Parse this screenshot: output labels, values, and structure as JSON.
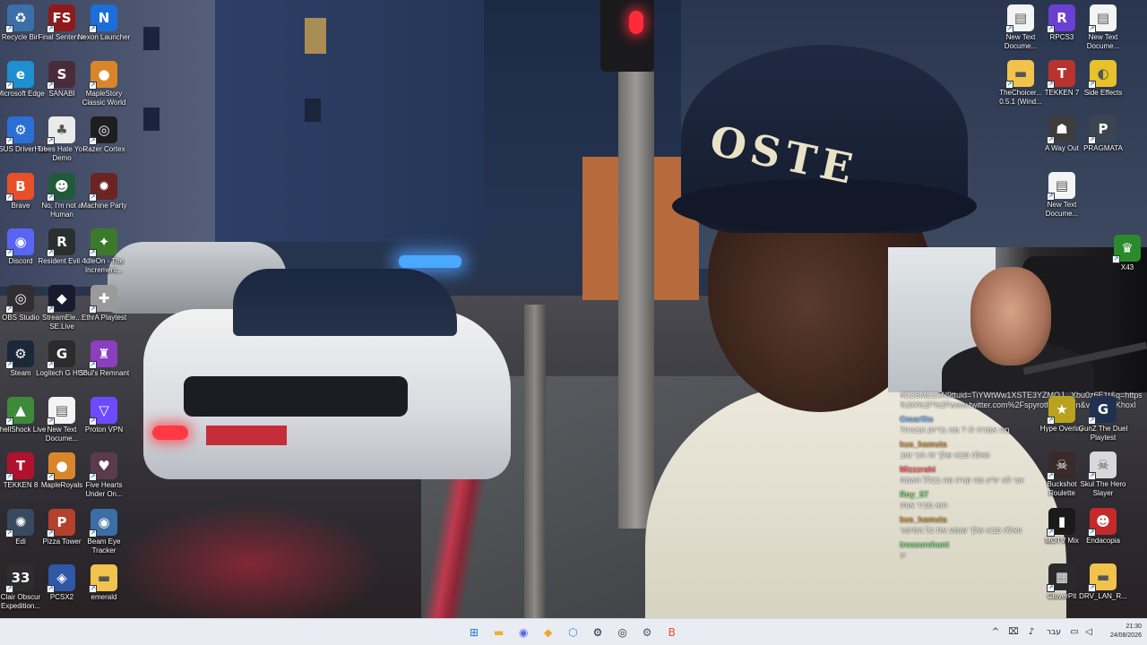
{
  "desktop": {
    "icons": [
      {
        "label": "Recycle Bin",
        "icon": "recycle-bin-icon",
        "color": "#3b6fa8",
        "glyph": "♻"
      },
      {
        "label": "Microsoft Edge",
        "icon": "edge-icon",
        "color": "#1f8fd1",
        "glyph": "e"
      },
      {
        "label": "ASUS DriverHub",
        "icon": "asus-driverhub-icon",
        "color": "#2b6fd6",
        "glyph": "⚙"
      },
      {
        "label": "Brave",
        "icon": "brave-icon",
        "color": "#e8502a",
        "glyph": "B"
      },
      {
        "label": "Discord",
        "icon": "discord-icon",
        "color": "#5865f2",
        "glyph": "◉"
      },
      {
        "label": "OBS Studio",
        "icon": "obs-icon",
        "color": "#302e31",
        "glyph": "◎"
      },
      {
        "label": "Steam",
        "icon": "steam-icon",
        "color": "#1b2838",
        "glyph": "⚙"
      },
      {
        "label": "ShellShock Live",
        "icon": "shellshock-icon",
        "color": "#3f8a3a",
        "glyph": "▲"
      },
      {
        "label": "TEKKEN 8",
        "icon": "tekken8-icon",
        "color": "#b0122e",
        "glyph": "T"
      },
      {
        "label": "Edi",
        "icon": "edi-icon",
        "color": "#3a4a5e",
        "glyph": "✺"
      },
      {
        "label": "Clair Obscur Expedition...",
        "icon": "clair-obscur-icon",
        "color": "#2d2d2d",
        "glyph": "33"
      },
      {
        "label": "Final Sentence",
        "icon": "final-sentence-icon",
        "color": "#8e1b1b",
        "glyph": "FS"
      },
      {
        "label": "SANABI",
        "icon": "sanabi-icon",
        "color": "#4a2b3a",
        "glyph": "S"
      },
      {
        "label": "Trees Hate You Demo",
        "icon": "trees-hate-you-icon",
        "color": "#eaeaea",
        "glyph": "♣"
      },
      {
        "label": "No, I'm not a Human",
        "icon": "not-human-icon",
        "color": "#1f5a3b",
        "glyph": "☻"
      },
      {
        "label": "Resident Evil 4",
        "icon": "re4-icon",
        "color": "#2a2f30",
        "glyph": "R"
      },
      {
        "label": "StreamEle... SE.Live",
        "icon": "streamelements-icon",
        "color": "#1a1a2e",
        "glyph": "◆"
      },
      {
        "label": "Logitech G HUB",
        "icon": "logitech-ghub-icon",
        "color": "#2b2b2b",
        "glyph": "G"
      },
      {
        "label": "New Text Docume...",
        "icon": "text-document-icon",
        "color": "#f4f4f4",
        "glyph": "▤"
      },
      {
        "label": "MapleRoyals",
        "icon": "mapleroyals-icon",
        "color": "#d9862a",
        "glyph": "●"
      },
      {
        "label": "Pizza Tower",
        "icon": "pizza-tower-icon",
        "color": "#b3412b",
        "glyph": "P"
      },
      {
        "label": "PCSX2",
        "icon": "pcsx2-icon",
        "color": "#2f57a6",
        "glyph": "◈"
      },
      {
        "label": "Nexon Launcher",
        "icon": "nexon-launcher-icon",
        "color": "#1b6fd8",
        "glyph": "N"
      },
      {
        "label": "MapleStory Classic World",
        "icon": "maplestory-classic-icon",
        "color": "#d9862a",
        "glyph": "●"
      },
      {
        "label": "Razer Cortex",
        "icon": "razer-cortex-icon",
        "color": "#1e1e1e",
        "glyph": "◎"
      },
      {
        "label": "Machine Party",
        "icon": "machine-party-icon",
        "color": "#6b2424",
        "glyph": "✹"
      },
      {
        "label": "IdleOn - The Increment...",
        "icon": "idleon-icon",
        "color": "#3c7a2b",
        "glyph": "✦"
      },
      {
        "label": "EthrA Playtest",
        "icon": "ethra-icon",
        "color": "#9a9a9a",
        "glyph": "✚"
      },
      {
        "label": "Soul's Remnant",
        "icon": "souls-remnant-icon",
        "color": "#8a3fbf",
        "glyph": "♜"
      },
      {
        "label": "Proton VPN",
        "icon": "proton-vpn-icon",
        "color": "#6d4aff",
        "glyph": "▽"
      },
      {
        "label": "Five Hearts Under On...",
        "icon": "five-hearts-icon",
        "color": "#5a3b4e",
        "glyph": "♥"
      },
      {
        "label": "Beam Eye Tracker",
        "icon": "beam-eye-tracker-icon",
        "color": "#3a6ea5",
        "glyph": "◉"
      },
      {
        "label": "emerald",
        "icon": "folder-icon",
        "color": "#f1c24c",
        "glyph": "▬"
      },
      {
        "label": "New Text Docume...",
        "icon": "text-document-icon",
        "color": "#f4f4f4",
        "glyph": "▤"
      },
      {
        "label": "TheChoicer... 0.5.1 (Wind...",
        "icon": "folder-icon",
        "color": "#f1c24c",
        "glyph": "▬"
      },
      {
        "label": "RPCS3",
        "icon": "rpcs3-icon",
        "color": "#6a3fd1",
        "glyph": "R"
      },
      {
        "label": "TEKKEN 7",
        "icon": "tekken7-icon",
        "color": "#b8332e",
        "glyph": "T"
      },
      {
        "label": "A Way Out",
        "icon": "a-way-out-icon",
        "color": "#3d3d3d",
        "glyph": "☗"
      },
      {
        "label": "New Text Docume...",
        "icon": "text-document-icon",
        "color": "#f4f4f4",
        "glyph": "▤"
      },
      {
        "label": "Hype Overlay",
        "icon": "hype-overlay-icon",
        "color": "#b8a21f",
        "glyph": "★"
      },
      {
        "label": "Buckshot Roulette",
        "icon": "buckshot-roulette-icon",
        "color": "#3a2a2a",
        "glyph": "☠"
      },
      {
        "label": "MOTV Mix",
        "icon": "motv-mix-icon",
        "color": "#1a1a1a",
        "glyph": "▮"
      },
      {
        "label": "CloverPit",
        "icon": "cloverpit-icon",
        "color": "#2a2a2a",
        "glyph": "▦"
      },
      {
        "label": "New Text Docume...",
        "icon": "text-document-icon",
        "color": "#f4f4f4",
        "glyph": "▤"
      },
      {
        "label": "Side Effects",
        "icon": "side-effects-icon",
        "color": "#e8c22a",
        "glyph": "◐"
      },
      {
        "label": "PRAGMATA",
        "icon": "pragmata-icon",
        "color": "#3b4550",
        "glyph": "P"
      },
      {
        "label": "GunZ The Duel Playtest",
        "icon": "gunz-icon",
        "color": "#1f3050",
        "glyph": "G"
      },
      {
        "label": "Skul The Hero Slayer",
        "icon": "skul-icon",
        "color": "#d8d8d8",
        "glyph": "☠"
      },
      {
        "label": "Endacopia",
        "icon": "endacopia-icon",
        "color": "#c42a2a",
        "glyph": "☻"
      },
      {
        "label": "DRV_LAN_R...",
        "icon": "folder-icon",
        "color": "#f1c24c",
        "glyph": "▬"
      },
      {
        "label": "X43",
        "icon": "x43-badge-icon",
        "color": "#2b8a2b",
        "glyph": "♛"
      }
    ]
  },
  "video": {
    "hat_text": "OSTE"
  },
  "chat": {
    "link_line_1": "#D2SMDZkN9ttuid=TiYWtWw1XSTE3YZMOJ...Xbu0z6E1t&q=https",
    "link_line_2": "%3A%2F%2Fwww.twitter.com%2Fspyrothedragon&v=pQLjsKhoxl",
    "messages": [
      {
        "user": "Omarfito",
        "user_color": "#7fb8ff",
        "text": "מה אמרת לו ? מה בדיוק הבעיה?"
      },
      {
        "user": "kus_hamuta",
        "user_color": "#d2a050",
        "text": "וואלה סבא שלך זה הכי טוב"
      },
      {
        "user": "Mizzzrahi",
        "user_color": "#ff6a6a",
        "text": "אני לא יודע מה קורה פה בכלל האמת"
      },
      {
        "user": "Roy_57",
        "user_color": "#7ddc7d",
        "text": "הוא מכיר אותו"
      },
      {
        "user": "kus_hamuta",
        "user_color": "#d2a050",
        "text": "וואלה סבא שלך שומע את כל הסיפור"
      },
      {
        "user": "treasurehunt",
        "user_color": "#7ddc7d",
        "text": "יוו"
      }
    ]
  },
  "taskbar": {
    "apps": [
      {
        "name": "start-button",
        "glyph": "⊞",
        "color": "#1a73e8"
      },
      {
        "name": "file-explorer-icon",
        "glyph": "▬",
        "color": "#e8b32a"
      },
      {
        "name": "discord-icon",
        "glyph": "◉",
        "color": "#5865f2"
      },
      {
        "name": "streamelements-icon",
        "glyph": "◆",
        "color": "#e8a72a"
      },
      {
        "name": "vpn-icon",
        "glyph": "⬡",
        "color": "#3a8ad8"
      },
      {
        "name": "steam-icon",
        "glyph": "⚙",
        "color": "#1b2838"
      },
      {
        "name": "obs-icon",
        "glyph": "◎",
        "color": "#302e31"
      },
      {
        "name": "settings-icon",
        "glyph": "⚙",
        "color": "#4a6070"
      },
      {
        "name": "brave-icon",
        "glyph": "B",
        "color": "#e8502a"
      }
    ],
    "tray": {
      "chevron": "^",
      "network": "⌧",
      "mic": "♪",
      "language": "עבר",
      "notif": "▭",
      "speaker": "◁",
      "battery": "▯"
    },
    "time": "21:30",
    "date": "24/08/2026"
  }
}
